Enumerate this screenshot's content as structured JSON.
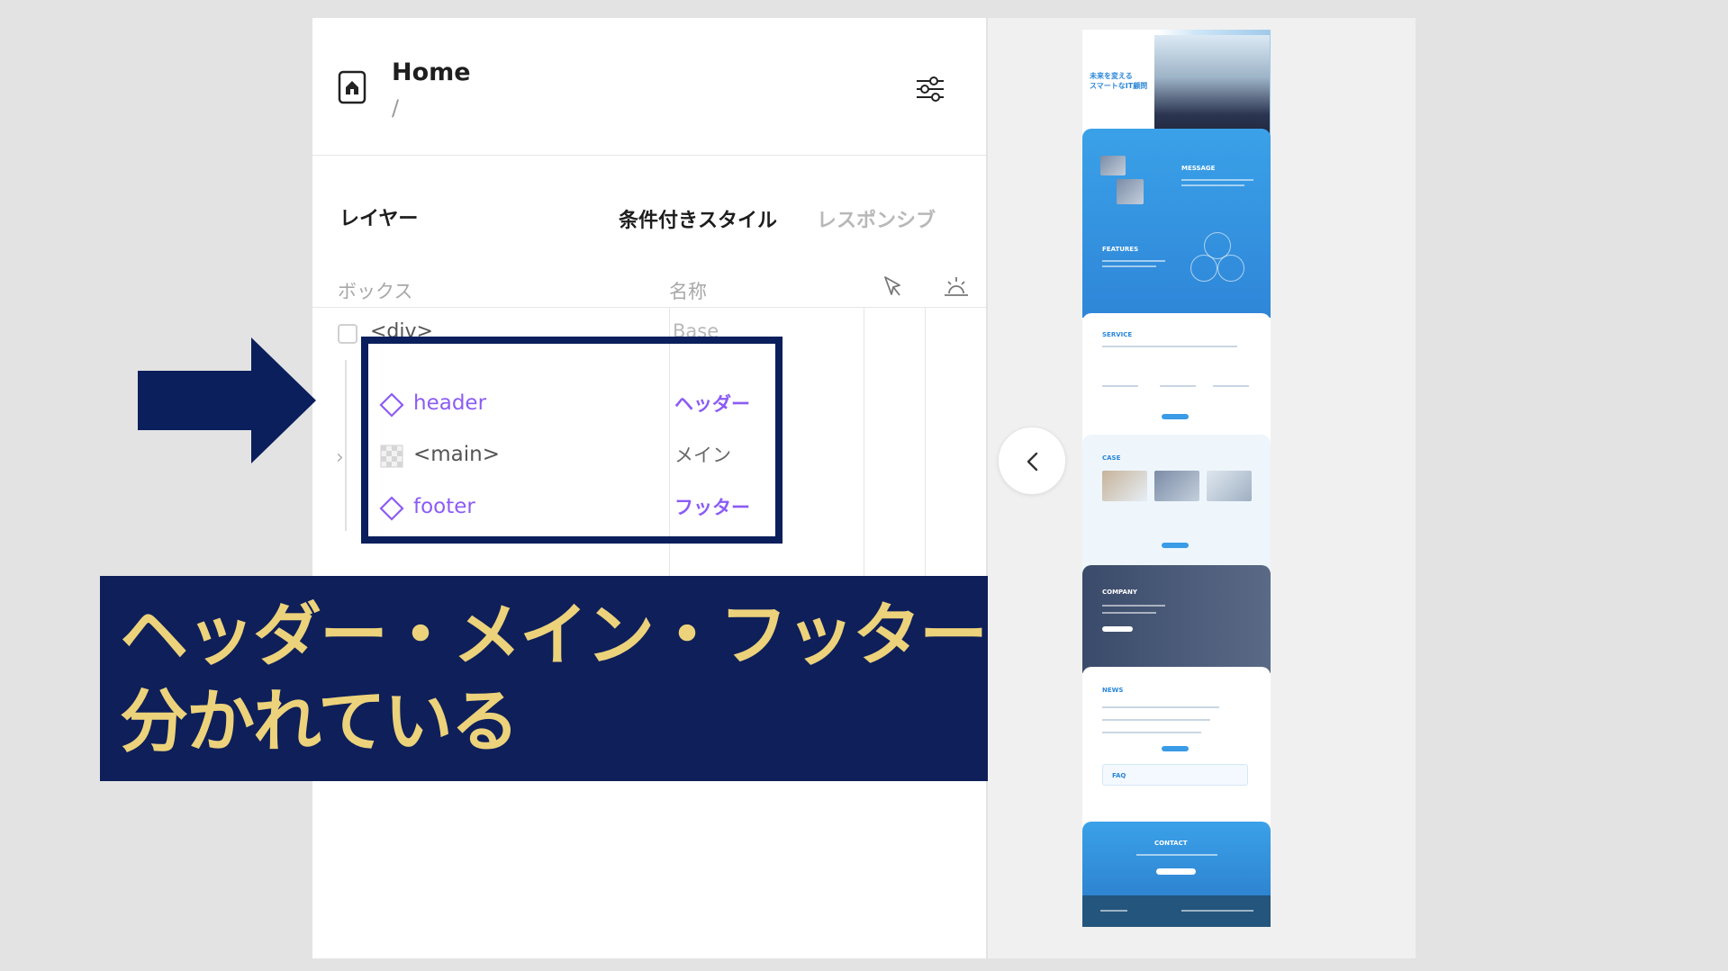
{
  "page_header": {
    "title": "Home",
    "path": "/"
  },
  "tabs": {
    "layers": "レイヤー",
    "conditional_styles": "条件付きスタイル",
    "responsive": "レスポンシブ"
  },
  "columns": {
    "box": "ボックス",
    "name": "名称"
  },
  "layers": {
    "root": {
      "tag": "<div>",
      "name": "Base"
    },
    "items": [
      {
        "tag": "header",
        "name": "ヘッダー",
        "type": "component",
        "color": "#8b5cf6"
      },
      {
        "tag": "<main>",
        "name": "メイン",
        "type": "element",
        "color": "#555555"
      },
      {
        "tag": "footer",
        "name": "フッター",
        "type": "component",
        "color": "#8b5cf6"
      }
    ]
  },
  "caption": {
    "line1": "ヘッダー・メイン・フッターに",
    "line2": "分かれている"
  },
  "colors": {
    "caption_bg": "#0e1f5a",
    "caption_text": "#ecd27a",
    "arrow": "#0a1f5c",
    "component": "#8b5cf6"
  },
  "preview": {
    "hero_title_line1": "未来を変える",
    "hero_title_line2": "スマートなIT顧問",
    "sections": [
      "MESSAGE",
      "FEATURES",
      "SERVICE",
      "CASE",
      "COMPANY",
      "NEWS",
      "FAQ",
      "CONTACT"
    ]
  }
}
